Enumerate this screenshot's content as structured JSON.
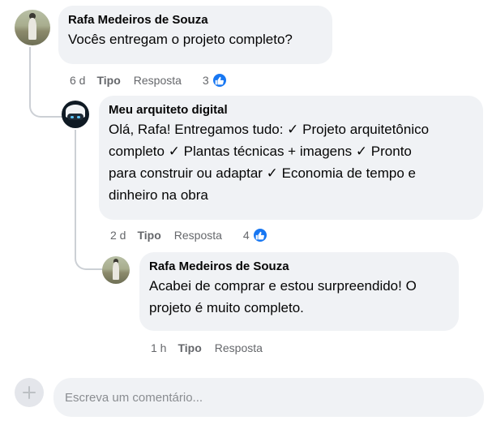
{
  "comments": [
    {
      "author": "Rafa Medeiros de Souza",
      "text": "Vocês entregam o projeto completo?",
      "time": "6 d",
      "like_label": "Tipo",
      "reply_label": "Resposta",
      "reaction_count": "3"
    },
    {
      "author": "Meu arquiteto digital",
      "text_lines": [
        "Olá, Rafa! Entregamos tudo: ✓ Projeto arquitetônico",
        "completo ✓ Plantas técnicas + imagens ✓ Pronto",
        "para construir ou adaptar ✓ Economia de tempo e",
        "dinheiro na obra"
      ],
      "time": "2 d",
      "like_label": "Tipo",
      "reply_label": "Resposta",
      "reaction_count": "4"
    },
    {
      "author": "Rafa Medeiros de Souza",
      "text_lines": [
        "Acabei de comprar e estou surpreendido! O",
        "projeto é muito completo."
      ],
      "time": "1 h",
      "like_label": "Tipo",
      "reply_label": "Resposta"
    }
  ],
  "composer": {
    "placeholder": "Escreva um comentário..."
  },
  "colors": {
    "bubble": "#f0f2f5",
    "like_blue": "#1877f2",
    "meta_gray": "#65676b"
  },
  "icons": {
    "reaction": "thumbs-up-icon",
    "composer": "plus-icon"
  }
}
